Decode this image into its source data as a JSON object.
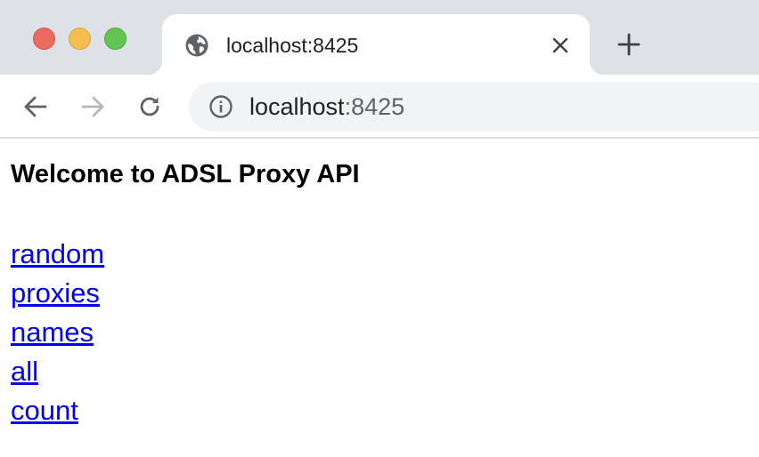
{
  "browser": {
    "tab": {
      "title": "localhost:8425",
      "favicon": "globe-icon"
    },
    "new_tab_icon": "plus-icon",
    "toolbar": {
      "back_icon": "arrow-left-icon",
      "forward_icon": "arrow-right-icon",
      "reload_icon": "reload-icon",
      "site_info_icon": "info-icon"
    },
    "address_bar": {
      "host": "localhost",
      "port": ":8425"
    },
    "traffic_lights": {
      "close_color": "#ed6a5e",
      "minimize_color": "#f5bf4f",
      "zoom_color": "#61c554"
    }
  },
  "page": {
    "heading": "Welcome to ADSL Proxy API",
    "links": [
      {
        "label": "random"
      },
      {
        "label": "proxies"
      },
      {
        "label": "names"
      },
      {
        "label": "all"
      },
      {
        "label": "count"
      }
    ],
    "link_color": "#0000ee"
  }
}
